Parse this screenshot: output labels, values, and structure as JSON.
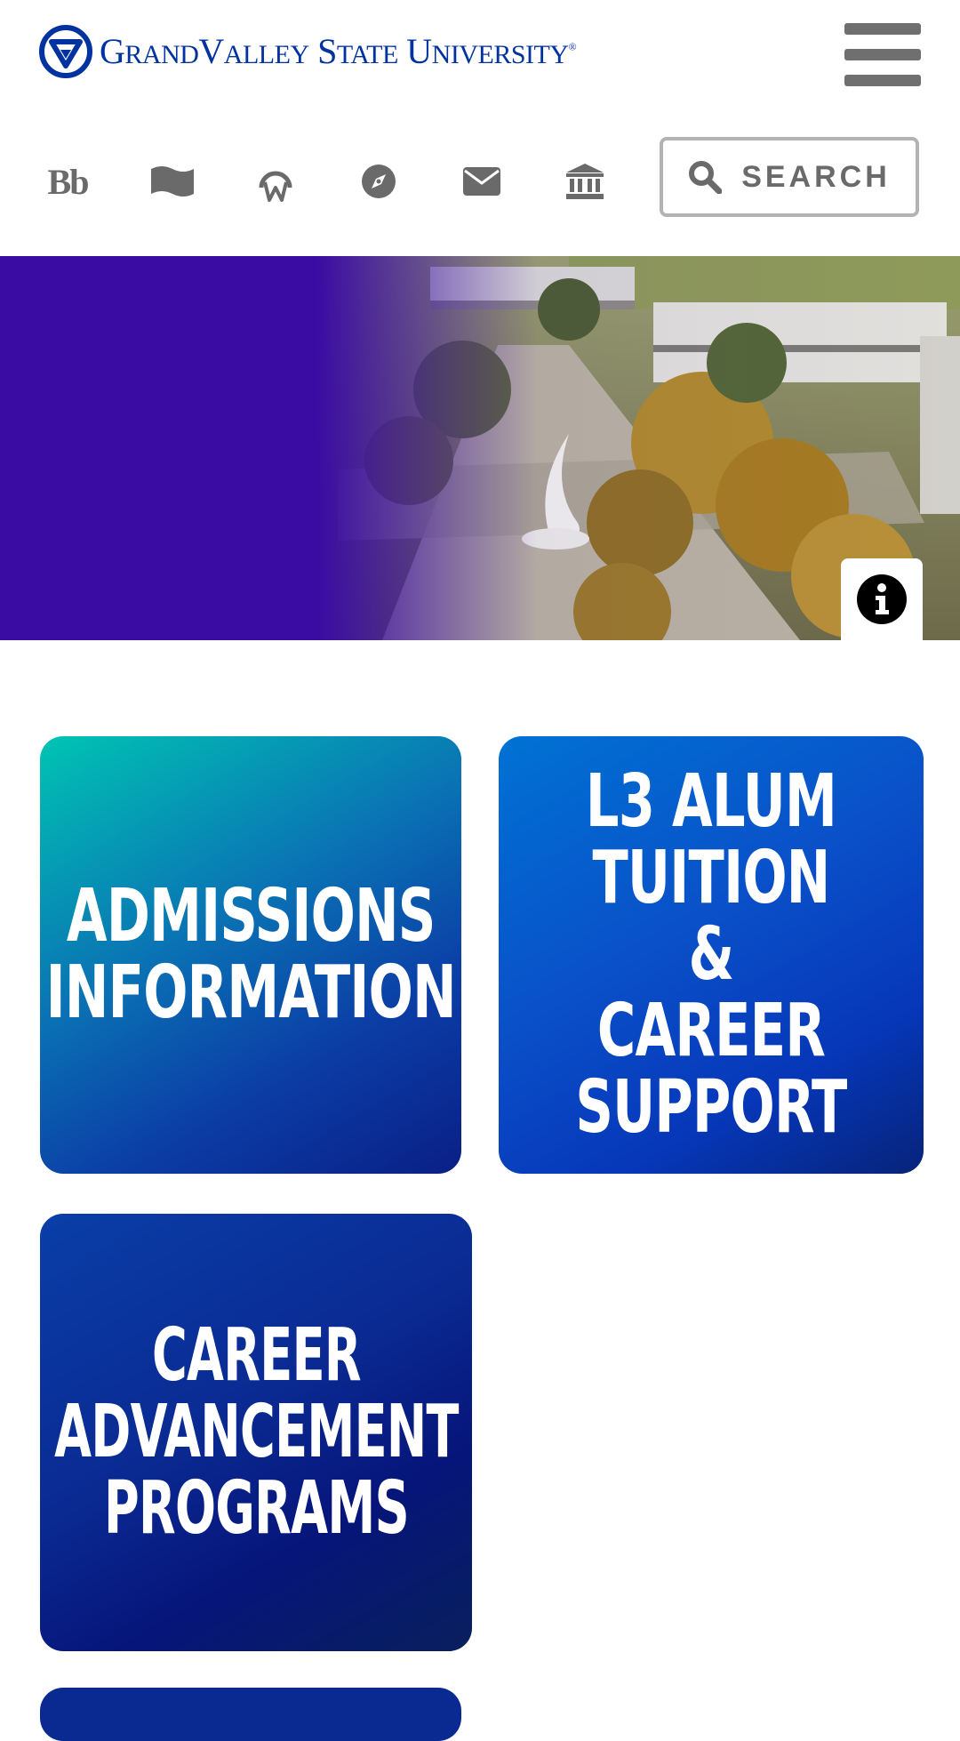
{
  "header": {
    "logo": {
      "prefix_g": "G",
      "rand": "RAND",
      "v": "V",
      "alley": "ALLEY",
      "s": "S",
      "tate": "TATE",
      "u": "U",
      "niversity": "NIVERSITY",
      "registered": "®"
    },
    "menu_icon": "hamburger-menu-icon",
    "quick_links": [
      {
        "name": "blackboard",
        "text": "Bb"
      },
      {
        "name": "map",
        "icon": "map-icon"
      },
      {
        "name": "wellness",
        "icon": "wellness-icon"
      },
      {
        "name": "explore",
        "icon": "compass-icon"
      },
      {
        "name": "email",
        "icon": "envelope-icon"
      },
      {
        "name": "institution",
        "icon": "bank-icon"
      }
    ],
    "search_label": "SEARCH"
  },
  "hero": {
    "info_icon": "info-icon"
  },
  "tiles": [
    {
      "label": "ADMISSIONS\nINFORMATION"
    },
    {
      "label": "L3 ALUM\nTUITION\n& CAREER\nSUPPORT"
    },
    {
      "label": "CAREER\nADVANCEMENT\nPROGRAMS"
    }
  ],
  "colors": {
    "brand_blue": "#0032a0",
    "icon_gray": "#6a6a6a",
    "hero_purple": "#3a0ca3"
  }
}
